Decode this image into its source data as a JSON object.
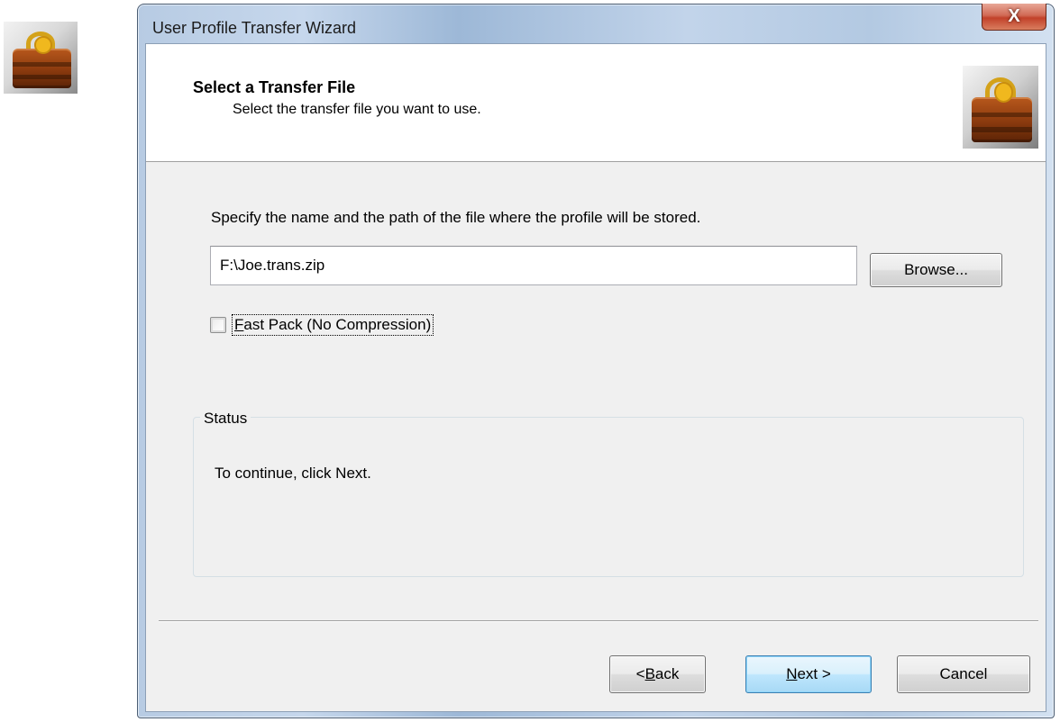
{
  "window": {
    "title": "User Profile Transfer Wizard",
    "close_glyph": "X"
  },
  "header": {
    "title": "Select a Transfer File",
    "subtitle": "Select the transfer file you want to use.",
    "icon": "bag-icon"
  },
  "desktop": {
    "icon": "bag-icon"
  },
  "form": {
    "instructions": "Specify the name and the path of the file where the profile will be stored.",
    "file_path": "F:\\Joe.trans.zip",
    "browse_label": "Browse...",
    "fast_pack": {
      "accelerator": "F",
      "label_rest": "ast Pack (No Compression)",
      "checked": false
    }
  },
  "status": {
    "legend": "Status",
    "message": "To continue, click Next."
  },
  "buttons": {
    "back": {
      "prefix": "< ",
      "accelerator": "B",
      "rest": "ack"
    },
    "next": {
      "accelerator": "N",
      "rest": "ext >"
    },
    "cancel": "Cancel"
  },
  "colors": {
    "dialog_bg": "#f0f0f0",
    "header_bg": "#ffffff",
    "default_button_border": "#3c7fb1",
    "close_button_red": "#c2412a"
  }
}
